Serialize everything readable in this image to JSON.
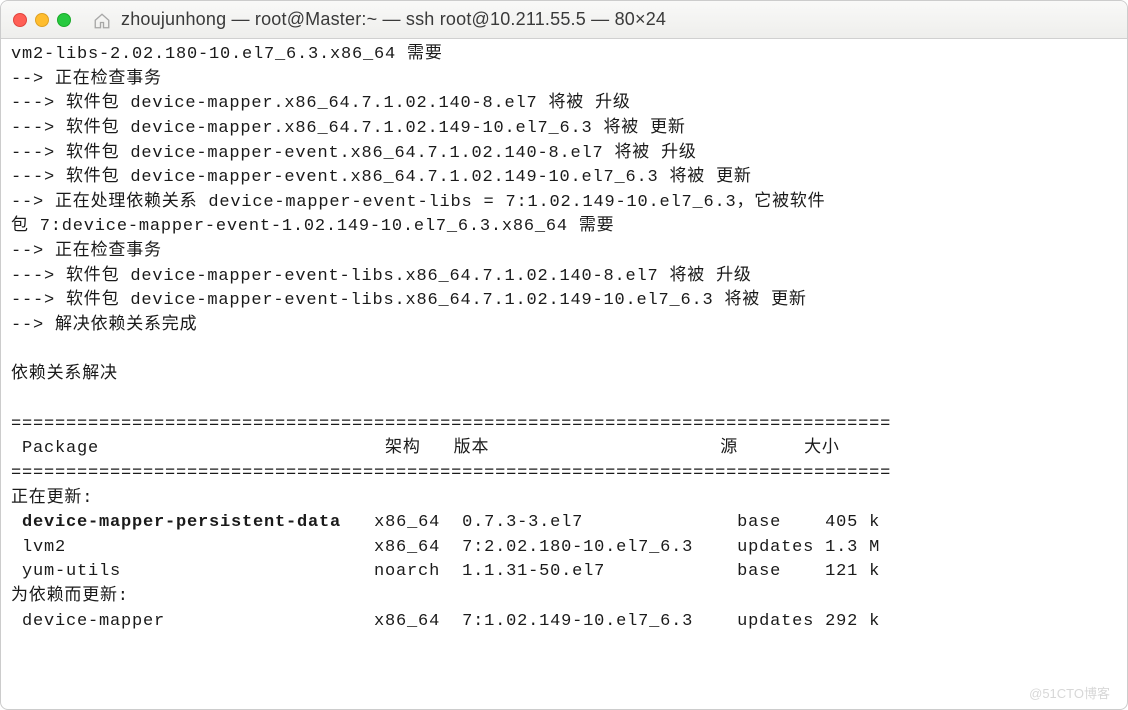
{
  "window": {
    "title": "zhoujunhong — root@Master:~ — ssh root@10.211.55.5 — 80×24"
  },
  "terminal": {
    "lines": [
      {
        "text": "vm2-libs-2.02.180-10.el7_6.3.x86_64 需要",
        "bold": false
      },
      {
        "text": "--> 正在检查事务",
        "bold": false
      },
      {
        "text": "---> 软件包 device-mapper.x86_64.7.1.02.140-8.el7 将被 升级",
        "bold": false
      },
      {
        "text": "---> 软件包 device-mapper.x86_64.7.1.02.149-10.el7_6.3 将被 更新",
        "bold": false
      },
      {
        "text": "---> 软件包 device-mapper-event.x86_64.7.1.02.140-8.el7 将被 升级",
        "bold": false
      },
      {
        "text": "---> 软件包 device-mapper-event.x86_64.7.1.02.149-10.el7_6.3 将被 更新",
        "bold": false
      },
      {
        "text": "--> 正在处理依赖关系 device-mapper-event-libs = 7:1.02.149-10.el7_6.3，它被软件",
        "bold": false
      },
      {
        "text": "包 7:device-mapper-event-1.02.149-10.el7_6.3.x86_64 需要",
        "bold": false
      },
      {
        "text": "--> 正在检查事务",
        "bold": false
      },
      {
        "text": "---> 软件包 device-mapper-event-libs.x86_64.7.1.02.140-8.el7 将被 升级",
        "bold": false
      },
      {
        "text": "---> 软件包 device-mapper-event-libs.x86_64.7.1.02.149-10.el7_6.3 将被 更新",
        "bold": false
      },
      {
        "text": "--> 解决依赖关系完成",
        "bold": false
      },
      {
        "text": "",
        "bold": false
      },
      {
        "text": "依赖关系解决",
        "bold": false
      },
      {
        "text": "",
        "bold": false
      },
      {
        "text": "================================================================================",
        "bold": false
      },
      {
        "text": " Package                          架构   版本                     源      大小",
        "bold": false
      },
      {
        "text": "================================================================================",
        "bold": false
      },
      {
        "text": "正在更新:",
        "bold": false
      },
      {
        "text": " device-mapper-persistent-data   x86_64  0.7.3-3.el7              base    405 k",
        "bold": true
      },
      {
        "text": " lvm2                            x86_64  7:2.02.180-10.el7_6.3    updates 1.3 M",
        "bold": false
      },
      {
        "text": " yum-utils                       noarch  1.1.31-50.el7            base    121 k",
        "bold": false
      },
      {
        "text": "为依赖而更新:",
        "bold": false
      },
      {
        "text": " device-mapper                   x86_64  7:1.02.149-10.el7_6.3    updates 292 k",
        "bold": false
      }
    ]
  },
  "watermark": "@51CTO博客"
}
